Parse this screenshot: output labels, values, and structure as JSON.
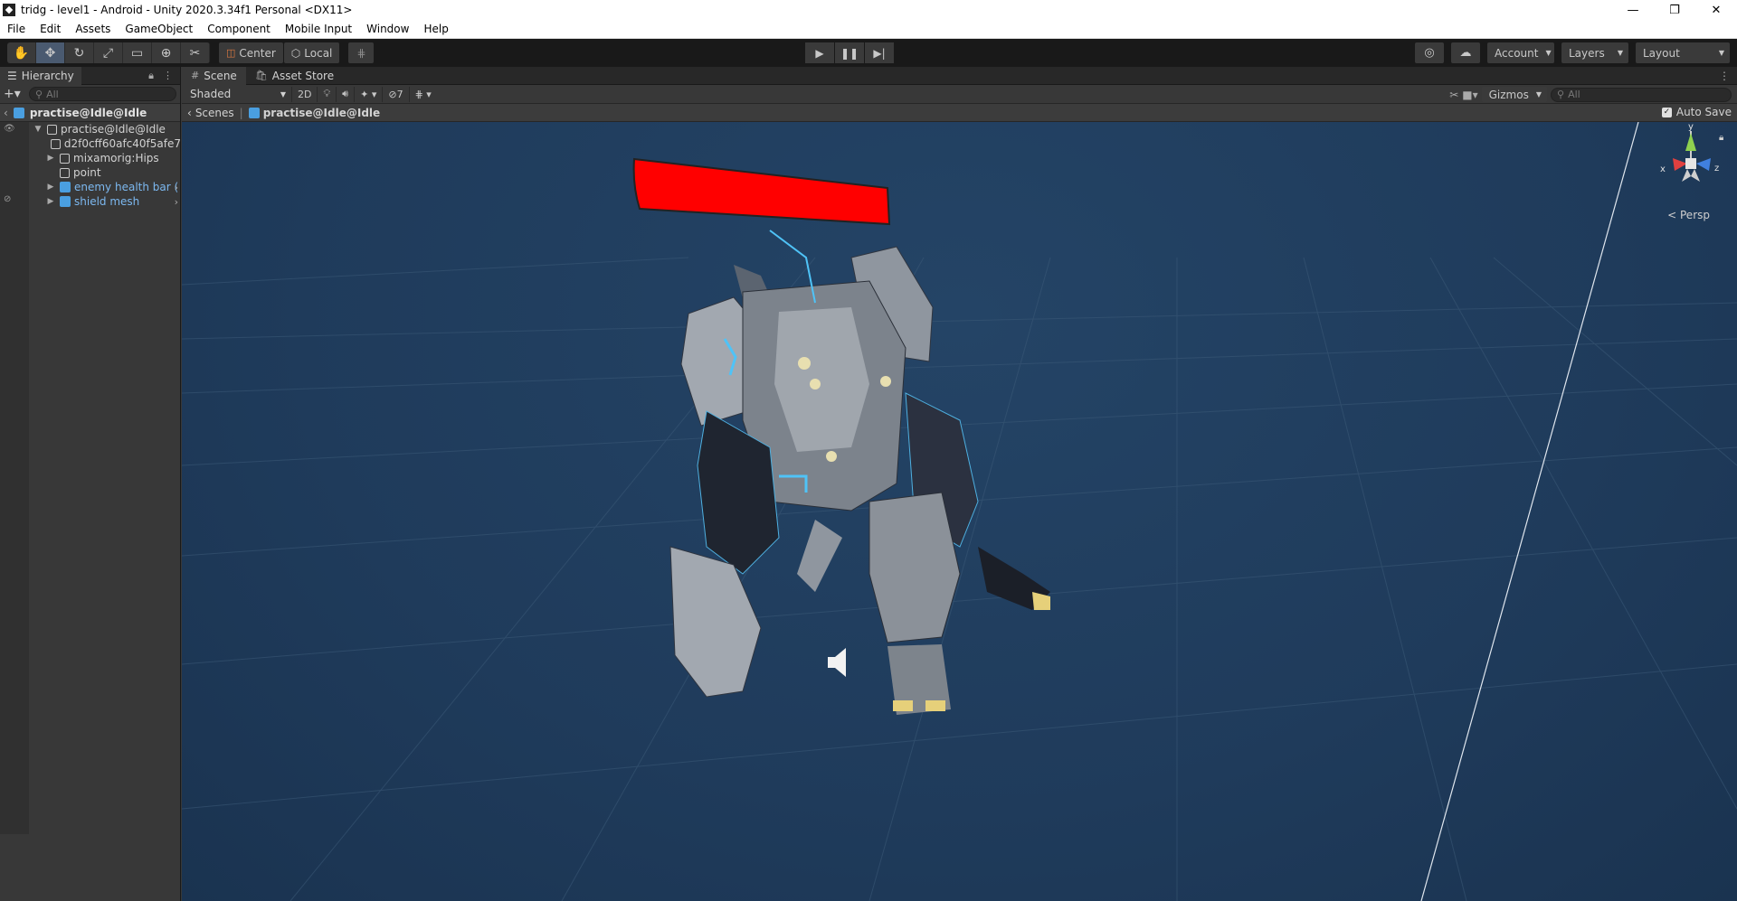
{
  "window": {
    "title": "tridg - level1 - Android - Unity 2020.3.34f1 Personal <DX11>",
    "controls": [
      "—",
      "❐",
      "✕"
    ]
  },
  "menu": [
    "File",
    "Edit",
    "Assets",
    "GameObject",
    "Component",
    "Mobile Input",
    "Window",
    "Help"
  ],
  "toolbar": {
    "pivot_label": "Center",
    "space_label": "Local",
    "account_label": "Account",
    "layers_label": "Layers",
    "layout_label": "Layout"
  },
  "hierarchy": {
    "tab_label": "Hierarchy",
    "search_placeholder": "All",
    "header_label": "practise@Idle@Idle",
    "items": [
      {
        "label": "practise@Idle@Idle",
        "depth": 0,
        "expanded": true,
        "prefab": false
      },
      {
        "label": "d2f0cff60afc40f5afe7",
        "depth": 1,
        "expanded": null,
        "prefab": false
      },
      {
        "label": "mixamorig:Hips",
        "depth": 1,
        "expanded": false,
        "prefab": false
      },
      {
        "label": "point",
        "depth": 1,
        "expanded": null,
        "prefab": false
      },
      {
        "label": "enemy health bar (",
        "depth": 1,
        "expanded": false,
        "prefab": true
      },
      {
        "label": "shield mesh",
        "depth": 1,
        "expanded": false,
        "prefab": true
      }
    ]
  },
  "scene": {
    "tabs": [
      "Scene",
      "Asset Store"
    ],
    "shading_mode": "Shaded",
    "mode_2d": "2D",
    "hidden_count": "7",
    "gizmos_label": "Gizmos",
    "search_placeholder": "All",
    "breadcrumb": [
      "Scenes",
      "practise@Idle@Idle"
    ],
    "autosave_label": "Auto Save",
    "autosave_checked": true,
    "projection_label": "Persp",
    "axis_labels": {
      "x": "x",
      "y": "y",
      "z": "z"
    },
    "health_bar_color": "#ff0000",
    "background_color": "#1f3b5b"
  }
}
